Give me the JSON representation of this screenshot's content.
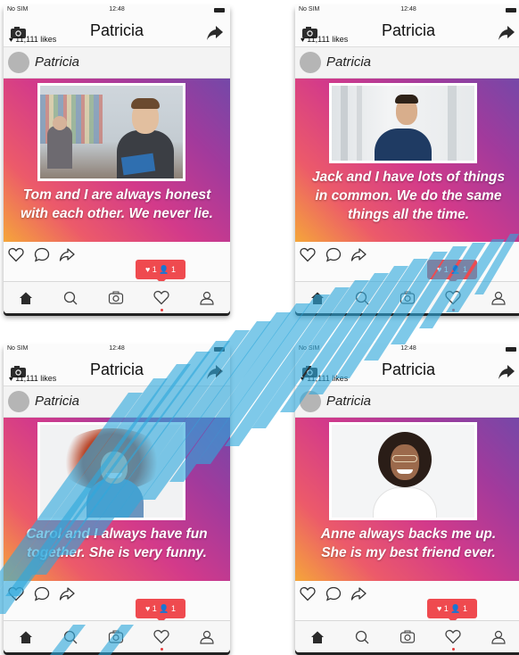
{
  "status": {
    "carrier": "No SIM",
    "time": "12:48"
  },
  "profile_name": "Patricia",
  "likes_text": "11,111 likes",
  "notification": {
    "likes": "1",
    "followers": "1"
  },
  "posts": [
    {
      "caption_lines": [
        "Tom and I are always honest",
        "with each other. We never lie."
      ]
    },
    {
      "caption_lines": [
        "Jack and I have lots of things",
        "in common. We do the same",
        "things all the time."
      ]
    },
    {
      "caption_lines": [
        "Carol and I always have fun",
        "together. She is very funny."
      ]
    },
    {
      "caption_lines": [
        "Anne always backs me up.",
        "She is my best friend ever."
      ]
    }
  ],
  "icons": {
    "titlebar": [
      "camera-icon",
      "share-icon"
    ],
    "actions": [
      "heart-outline-icon",
      "comment-icon",
      "share-arrow-icon"
    ],
    "navbar": [
      "home-icon",
      "search-icon",
      "camera-icon",
      "heart-icon",
      "profile-icon"
    ]
  },
  "colors": {
    "gradient": [
      "#f5a63a",
      "#ec5a6a",
      "#d33a8a",
      "#a23a9c",
      "#7448a8"
    ],
    "notification": "#ef4a4f",
    "watermark_stripes": "#2fa8dc"
  }
}
